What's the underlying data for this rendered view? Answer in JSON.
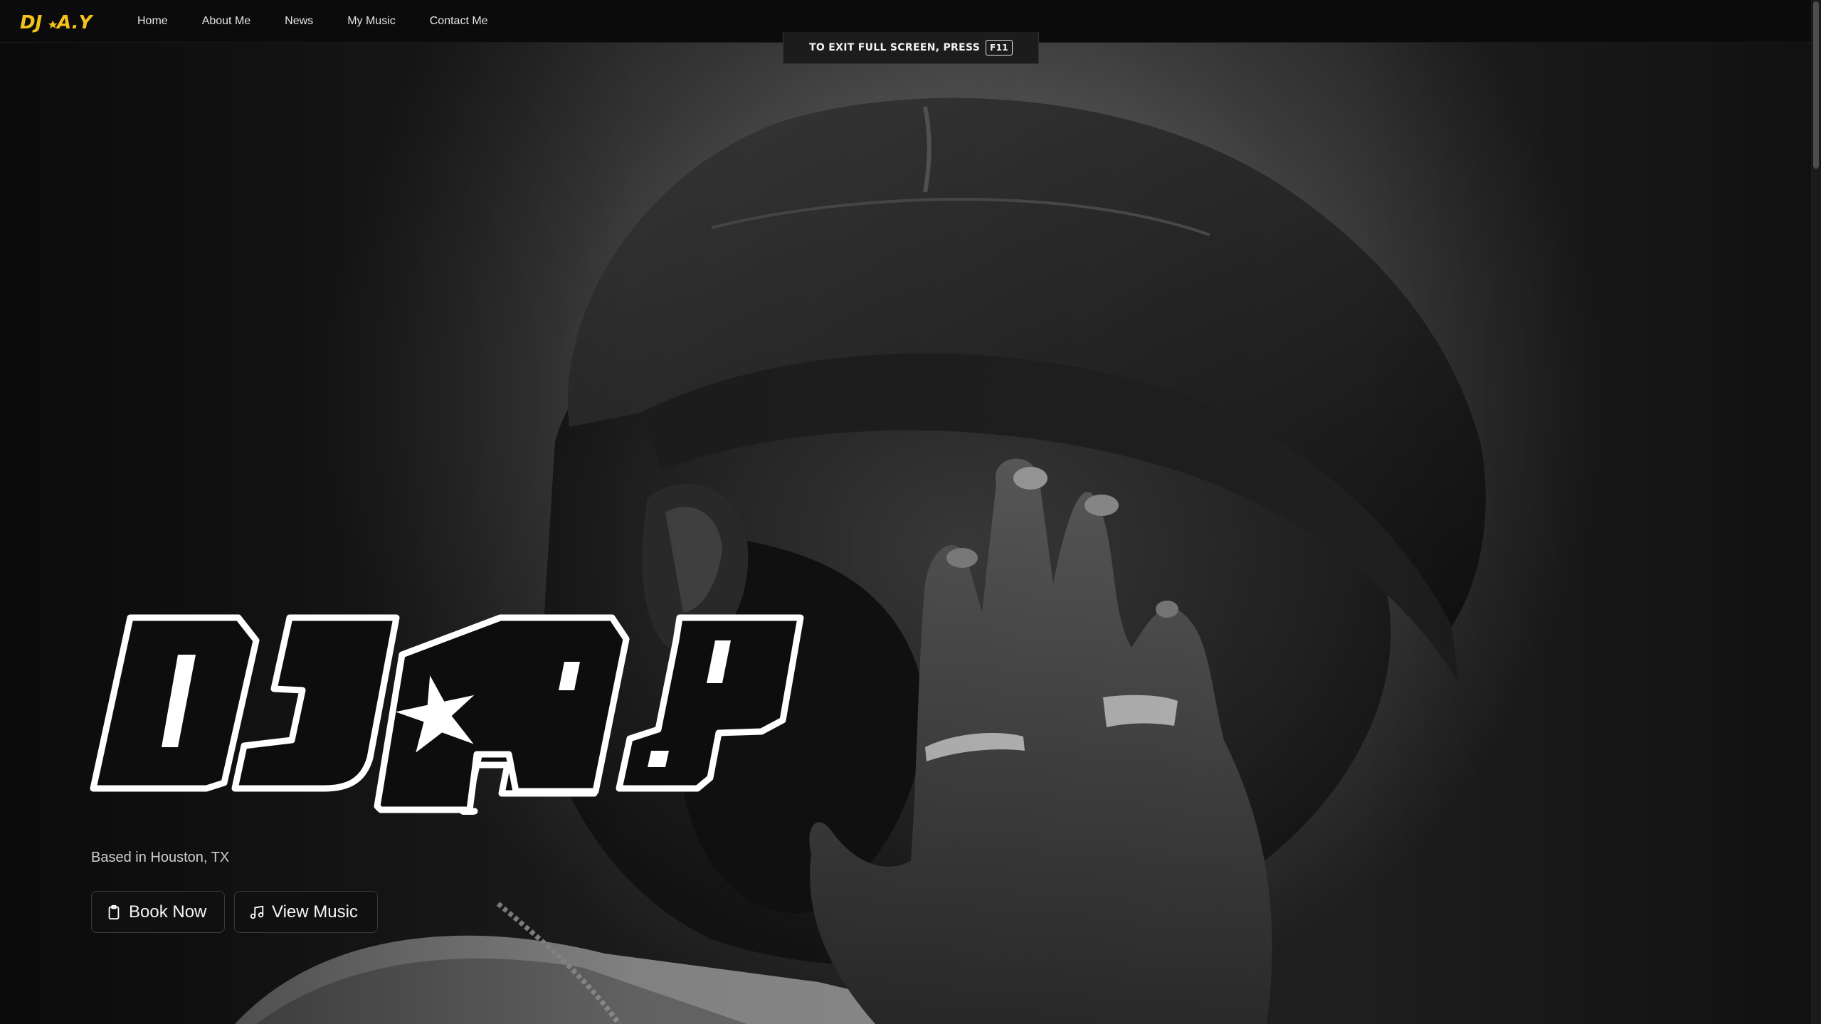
{
  "nav": {
    "brand": "DJ★A.Y",
    "links": [
      "Home",
      "About Me",
      "News",
      "My Music",
      "Contact Me"
    ]
  },
  "fullscreen_notice": {
    "text": "TO EXIT FULL SCREEN, PRESS",
    "key": "F11"
  },
  "hero": {
    "logo_text": "DJ★A.Y",
    "tagline": "Based in Houston, TX",
    "buttons": {
      "book": "Book Now",
      "music": "View Music"
    }
  },
  "colors": {
    "brand_yellow": "#f2c21b",
    "background": "#0d0d0d",
    "button_bg": "#101010"
  },
  "icons": {
    "book": "clipboard-icon",
    "music": "music-note-icon"
  }
}
